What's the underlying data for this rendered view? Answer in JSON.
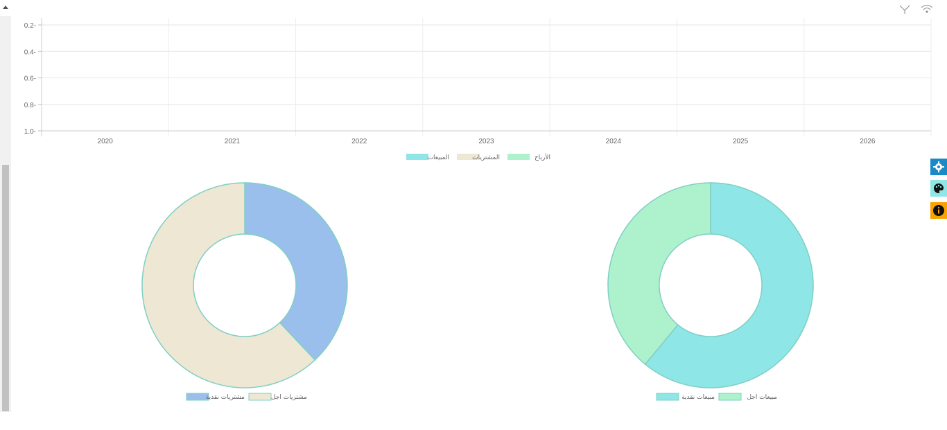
{
  "line_chart": {
    "chart_data": {
      "type": "line",
      "y_ticks": [
        "0.2-",
        "0.4-",
        "0.6-",
        "0.8-",
        "1.0-"
      ],
      "x_ticks": [
        "2020",
        "2021",
        "2022",
        "2023",
        "2024",
        "2025",
        "2026"
      ],
      "ylim": [
        0.2,
        1.0
      ],
      "grid": true,
      "legend": [
        {
          "label": "المبيعات",
          "color": "#8ee6e6"
        },
        {
          "label": "المشتريات",
          "color": "#ede7d3"
        },
        {
          "label": "الأرباح",
          "color": "#aef2cd"
        }
      ]
    }
  },
  "donut_left": {
    "chart_data": {
      "type": "pie",
      "values": [
        38,
        62
      ],
      "colors": [
        "#9bbfec",
        "#ede7d3"
      ],
      "legend": [
        {
          "label": "مشتريات نقدية",
          "color": "#9bbfec"
        },
        {
          "label": "مشتريات اجل",
          "color": "#ede7d3"
        }
      ]
    }
  },
  "donut_right": {
    "chart_data": {
      "type": "pie",
      "values": [
        61,
        39
      ],
      "colors": [
        "#8ee6e6",
        "#aef2cd"
      ],
      "legend": [
        {
          "label": "مبيعات نقدية",
          "color": "#8ee6e6"
        },
        {
          "label": "مبيعات اجل",
          "color": "#aef2cd"
        }
      ]
    }
  },
  "side_buttons": [
    {
      "icon": "gear-icon",
      "color": "#1a8ac7"
    },
    {
      "icon": "palette-icon",
      "color": "#8ee6e6"
    },
    {
      "icon": "info-icon",
      "color": "#f7a400"
    }
  ],
  "topbar_icons": [
    "signal-icon",
    "antenna-icon",
    "wifi-icon"
  ]
}
